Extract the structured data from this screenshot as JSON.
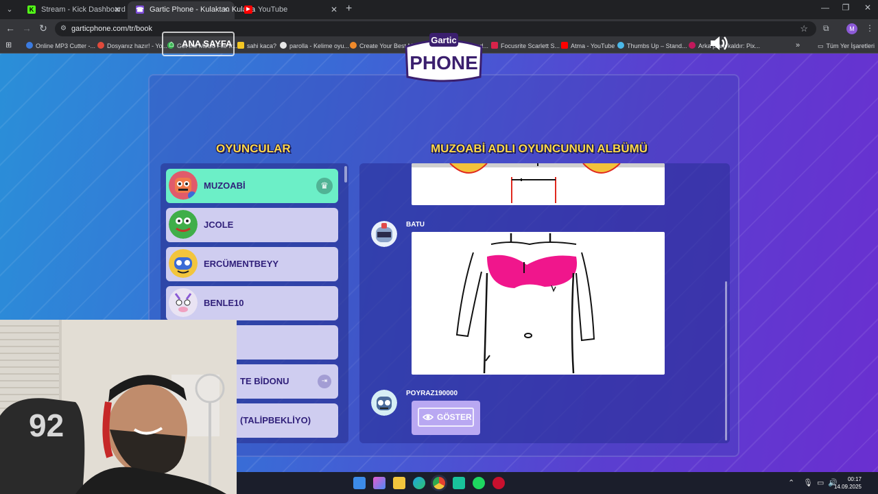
{
  "browser": {
    "tabs": [
      {
        "label": "Stream - Kick Dashboard",
        "icon": "kick-icon",
        "color": "#53fc18"
      },
      {
        "label": "Gartic Phone - Kulaktan Kulağa",
        "icon": "gartic-icon",
        "color": "#7b4bd6"
      },
      {
        "label": "YouTube",
        "icon": "youtube-icon",
        "color": "#ff0000"
      }
    ],
    "url": "garticphone.com/tr/book",
    "bookmarks": [
      "Online MP3 Cutter -...",
      "Dosyanız hazır! - Yo...",
      "Get the M3U8 File fr...",
      "sahi kaca?",
      "parolla - Kelime oyu...",
      "Create Your Best M...",
      "Vocal Remover and...",
      "Focusrite Scarlett S...",
      "Atma - YouTube",
      "Thumbs Up – Stand...",
      "Arka planı kaldır: Pix..."
    ],
    "all_bookmarks": "Tüm Yer İşaretleri",
    "profile_initial": "M"
  },
  "game": {
    "home_label": "ANA SAYFA",
    "logo_top": "Gartic",
    "logo_bottom": "PHONE",
    "players_title": "OYUNCULAR",
    "album_title": "MUZOABİ ADLI OYUNCUNUN ALBÜMÜ",
    "players": [
      {
        "name": "MUZOABİ",
        "active": true
      },
      {
        "name": "JCOLE"
      },
      {
        "name": "ERCÜMENTBEYY"
      },
      {
        "name": "BENLE10"
      },
      {
        "name": ""
      },
      {
        "name": "TE BİDONU"
      },
      {
        "name": "(TALİPBEKLİYO)"
      }
    ],
    "album": {
      "author_1": "BATU",
      "author_2": "POYRAZ190000",
      "show_label": "GÖSTER"
    }
  },
  "taskbar": {
    "time": "00:17",
    "date": "14.09.2025"
  }
}
